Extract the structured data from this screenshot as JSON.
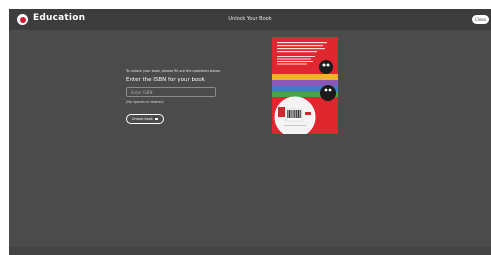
{
  "header": {
    "brand": "Education",
    "title": "Unlock Your Book",
    "close_label": "Close"
  },
  "form": {
    "intro": "To unlock your book, please fill out the questions below.",
    "prompt": "Enter the ISBN for your book",
    "isbn_placeholder": "Enter ISBN",
    "isbn_value": "",
    "hint": "(No spaces or dashes)",
    "unlock_label": "Unlock book"
  },
  "colors": {
    "background": "#4b4b4b",
    "header": "#3d3d3d",
    "brand_accent": "#d8192f",
    "book_cover": "#e0262e"
  },
  "icons": {
    "logo": "logo-circle-icon",
    "lock": "lock-icon"
  }
}
